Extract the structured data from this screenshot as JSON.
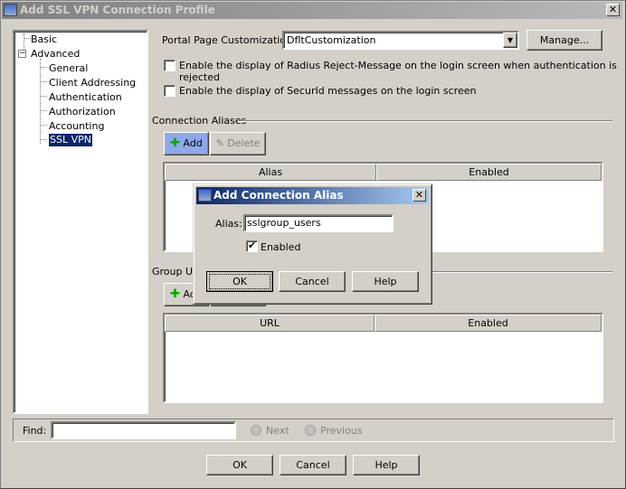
{
  "window": {
    "title": "Add SSL VPN Connection Profile"
  },
  "tree": {
    "items": [
      "Basic",
      "Advanced",
      "General",
      "Client Addressing",
      "Authentication",
      "Authorization",
      "Accounting",
      "SSL VPN"
    ],
    "selected": "SSL VPN"
  },
  "portal": {
    "label": "Portal Page Customization:",
    "value": "DfltCustomization",
    "manage": "Manage..."
  },
  "options": {
    "radius": "Enable the display of Radius Reject-Message on the login screen when authentication is rejected",
    "securid": "Enable the display of SecurId messages on the login screen"
  },
  "aliases": {
    "title": "Connection Aliases",
    "add": "Add",
    "delete": "Delete",
    "columns": [
      "Alias",
      "Enabled"
    ]
  },
  "urls": {
    "title": "Group URLs",
    "add": "Add",
    "columns": [
      "URL",
      "Enabled"
    ]
  },
  "find": {
    "label": "Find:",
    "value": "",
    "next": "Next",
    "previous": "Previous"
  },
  "footer": {
    "ok": "OK",
    "cancel": "Cancel",
    "help": "Help"
  },
  "dialog": {
    "title": "Add Connection Alias",
    "alias_label": "Alias:",
    "alias_value": "sslgroup_users",
    "enabled_label": "Enabled",
    "enabled": true,
    "ok": "OK",
    "cancel": "Cancel",
    "help": "Help"
  },
  "colors": {
    "selection": "#0a246a",
    "dialog_title_start": "#0a246a",
    "dialog_title_end": "#a6caf0",
    "add_active": "#8fa8e8"
  }
}
